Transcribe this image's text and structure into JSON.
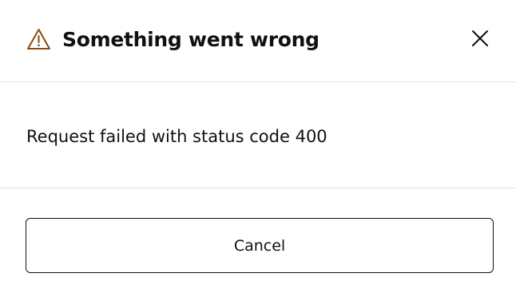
{
  "dialog": {
    "title": "Something went wrong",
    "title_icon": "warning-triangle-icon",
    "close_icon": "close-icon",
    "message": "Request failed with status code 400",
    "cancel_label": "Cancel"
  },
  "colors": {
    "warning_icon": "#8a4a12",
    "text": "#111111",
    "divider": "#e2e2e2",
    "button_border": "#111111",
    "background": "#ffffff"
  }
}
